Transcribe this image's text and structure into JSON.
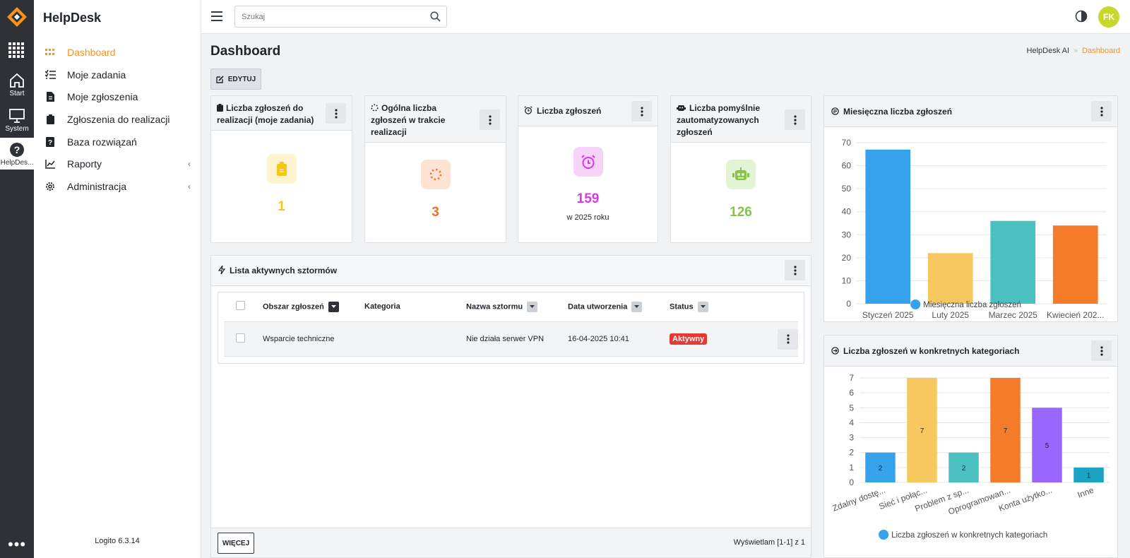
{
  "rail": {
    "items": [
      {
        "label": "Start",
        "icon": "home-icon"
      },
      {
        "label": "System",
        "icon": "monitor-icon"
      },
      {
        "label": "HelpDes...",
        "icon": "question-circle-icon"
      }
    ],
    "more": "•••"
  },
  "sidebar": {
    "brand": "HelpDesk",
    "items": [
      {
        "label": "Dashboard",
        "icon": "grid-icon",
        "active": true
      },
      {
        "label": "Moje zadania",
        "icon": "task-list-icon"
      },
      {
        "label": "Moje zgłoszenia",
        "icon": "document-icon"
      },
      {
        "label": "Zgłoszenia do realizacji",
        "icon": "clipboard-icon"
      },
      {
        "label": "Baza rozwiązań",
        "icon": "question-book-icon"
      },
      {
        "label": "Raporty",
        "icon": "chart-line-icon",
        "expandable": true
      },
      {
        "label": "Administracja",
        "icon": "gear-icon",
        "expandable": true
      }
    ],
    "version": "Logito 6.3.14"
  },
  "topbar": {
    "search_placeholder": "Szukaj",
    "avatar_initials": "FK"
  },
  "page": {
    "title": "Dashboard",
    "breadcrumb": [
      "HelpDesk AI",
      "Dashboard"
    ],
    "edit_label": "EDYTUJ"
  },
  "stats": [
    {
      "title": "Liczba zgłoszeń do realizacji (moje zadania)",
      "value": "1",
      "sub": "",
      "color": "#f5c518",
      "icon": "clipboard-icon"
    },
    {
      "title": "Ogólna liczba zgłoszeń w trakcie realizacji",
      "value": "3",
      "sub": "",
      "color": "#f37021",
      "icon": "spinner-icon"
    },
    {
      "title": "Liczba zgłoszeń",
      "value": "159",
      "sub": "w 2025 roku",
      "color": "#d63ae0",
      "icon": "alarm-clock-icon"
    },
    {
      "title": "Liczba pomyślnie zautomatyzowanych zgłoszeń",
      "value": "126",
      "sub": "",
      "color": "#8bc34a",
      "icon": "robot-icon"
    }
  ],
  "storm_list": {
    "title": "Lista aktywnych sztormów",
    "columns": [
      "Obszar zgłoszeń",
      "Kategoria",
      "Nazwa sztormu",
      "Data utworzenia",
      "Status"
    ],
    "rows": [
      {
        "area": "Wsparcie techniczne",
        "category": "",
        "name": "Nie działa serwer VPN",
        "date": "16-04-2025 10:41",
        "status": "Aktywny"
      }
    ],
    "more_label": "WIĘCEJ",
    "pagination": "Wyświetlam [1-1] z 1"
  },
  "chart_data": [
    {
      "type": "bar",
      "title": "Miesięczna liczba zgłoszeń",
      "categories": [
        "Styczeń 2025",
        "Luty 2025",
        "Marzec 2025",
        "Kwiecień 202..."
      ],
      "values": [
        67,
        22,
        36,
        34
      ],
      "colors": [
        "#36a2eb",
        "#f6c85f",
        "#4bc0c0",
        "#f47b2a"
      ],
      "ylim": [
        0,
        70
      ],
      "yticks": [
        0,
        10,
        20,
        30,
        40,
        50,
        60,
        70
      ],
      "legend": "Miesięczna liczba zgłoszeń",
      "legend_color": "#36a2eb",
      "grid": true,
      "data_labels": false
    },
    {
      "type": "bar",
      "title": "Liczba zgłoszeń w konkretnych kategoriach",
      "categories": [
        "Zdalny dostę...",
        "Sieć i połąc...",
        "Problem z sp...",
        "Oprogramowan...",
        "Konta użytko...",
        "Inne"
      ],
      "values": [
        2,
        7,
        2,
        7,
        5,
        1
      ],
      "colors": [
        "#36a2eb",
        "#f6c85f",
        "#4bc0c0",
        "#f47b2a",
        "#9966ff",
        "#1aa3c4"
      ],
      "ylim": [
        0,
        7
      ],
      "yticks": [
        0,
        1,
        2,
        3,
        4,
        5,
        6,
        7
      ],
      "legend": "Liczba zgłoszeń w konkretnych kategoriach",
      "legend_color": "#36a2eb",
      "grid": true,
      "data_labels": true
    }
  ]
}
